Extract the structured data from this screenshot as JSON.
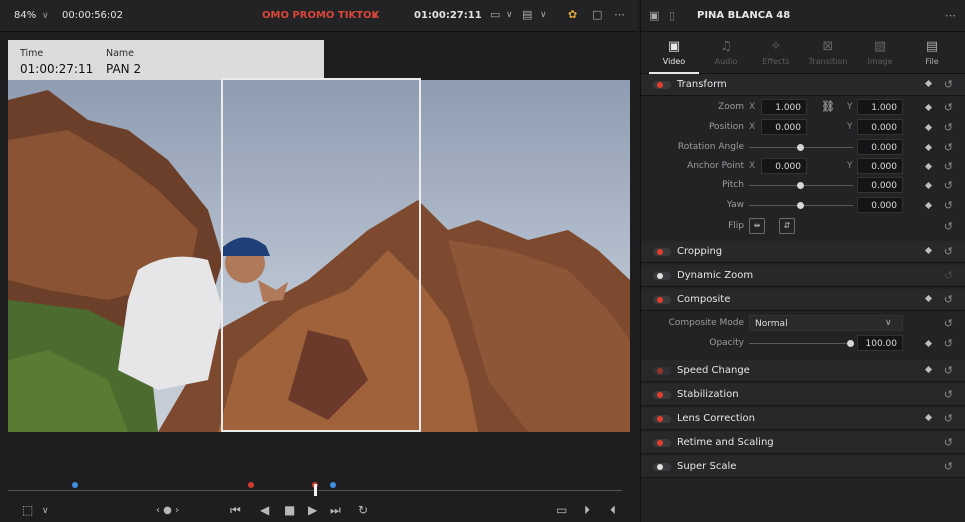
{
  "viewer": {
    "zoom": "84%",
    "timecode": "00:00:56:02",
    "project_title": "OMO PROMO TIKTOK",
    "current_timecode": "01:00:27:11",
    "clip_info": {
      "time_label": "Time",
      "time_value": "01:00:27:11",
      "name_label": "Name",
      "name_value": "PAN 2"
    }
  },
  "inspector": {
    "clip_name": "PINA BLANCA 48",
    "tabs": [
      {
        "label": "Video",
        "icon": "film-icon"
      },
      {
        "label": "Audio",
        "icon": "music-icon"
      },
      {
        "label": "Effects",
        "icon": "wand-icon"
      },
      {
        "label": "Transition",
        "icon": "transition-icon"
      },
      {
        "label": "Image",
        "icon": "image-icon"
      },
      {
        "label": "File",
        "icon": "file-icon"
      }
    ],
    "sections": {
      "transform": "Transform",
      "cropping": "Cropping",
      "dynamic_zoom": "Dynamic Zoom",
      "composite": "Composite",
      "speed_change": "Speed Change",
      "stabilization": "Stabilization",
      "lens_correction": "Lens Correction",
      "retime": "Retime and Scaling",
      "super_scale": "Super Scale"
    },
    "transform": {
      "zoom_label": "Zoom",
      "zoom_x": "1.000",
      "zoom_y": "1.000",
      "position_label": "Position",
      "position_x": "0.000",
      "position_y": "0.000",
      "rotation_label": "Rotation Angle",
      "rotation": "0.000",
      "anchor_label": "Anchor Point",
      "anchor_x": "0.000",
      "anchor_y": "0.000",
      "pitch_label": "Pitch",
      "pitch": "0.000",
      "yaw_label": "Yaw",
      "yaw": "0.000",
      "flip_label": "Flip",
      "x_axis": "X",
      "y_axis": "Y"
    },
    "composite": {
      "mode_label": "Composite Mode",
      "mode_value": "Normal",
      "opacity_label": "Opacity",
      "opacity_value": "100.00"
    }
  },
  "colors": {
    "accent_red": "#e53a2e",
    "panel_bg": "#232326"
  }
}
